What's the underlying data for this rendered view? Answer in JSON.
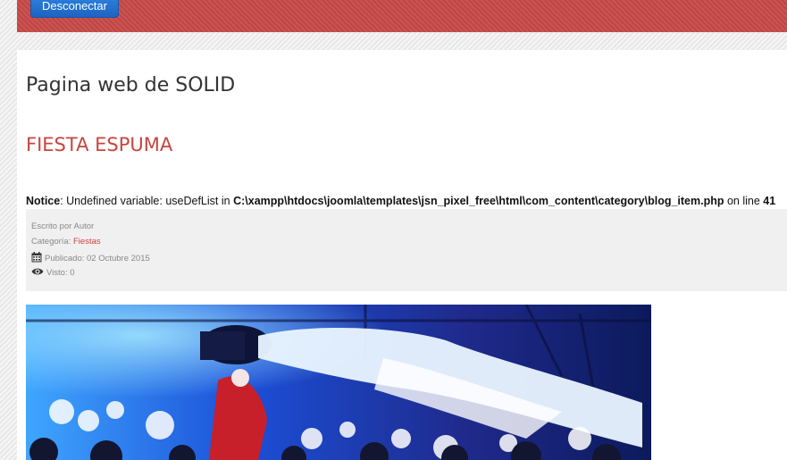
{
  "header": {
    "logout_label": "Desconectar",
    "accent_color": "#c84a48",
    "button_color": "#1d63c3"
  },
  "page": {
    "heading": "Pagina web de SOLID"
  },
  "article": {
    "title": "FIESTA ESPUMA",
    "title_color": "#c8453f",
    "notice": {
      "label": "Notice",
      "message": ": Undefined variable: useDefList in ",
      "path": "C:\\xampp\\htdocs\\joomla\\templates\\jsn_pixel_free\\html\\com_content\\category\\blog_item.php",
      "line_text": " on line ",
      "line_number": "41"
    },
    "meta": {
      "author": "Escrito por Autor",
      "category_label": "Categoría: ",
      "category_link": "Fiestas",
      "published": "Publicado: 02 Octubre 2015",
      "hits": "Visto: 0",
      "calendar_icon": "calendar-icon",
      "eye_icon": "eye-icon"
    },
    "image_alt": "Fiesta de espuma"
  }
}
